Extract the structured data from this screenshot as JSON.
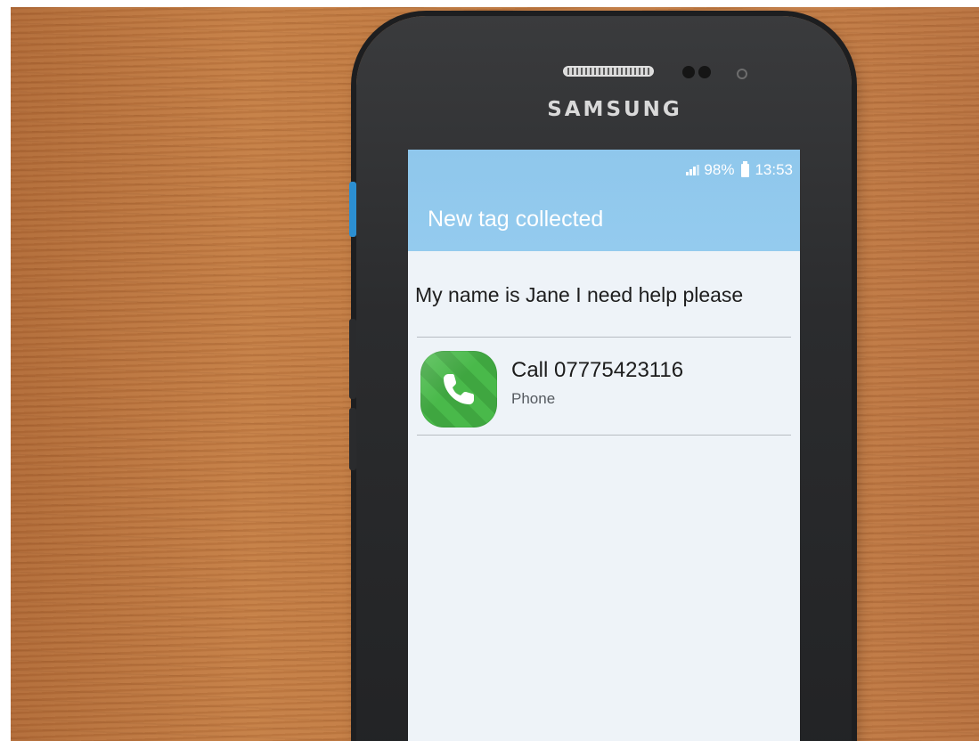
{
  "device": {
    "brand": "SAMSUNG"
  },
  "status_bar": {
    "battery": "98%",
    "time": "13:53"
  },
  "app": {
    "title": "New tag collected",
    "header_color": "#94cbee"
  },
  "tag": {
    "message": "My name is Jane I need help please"
  },
  "action": {
    "label": "Call 07775423116",
    "app_name": "Phone",
    "icon": "phone-icon",
    "icon_color": "#49b94a"
  }
}
